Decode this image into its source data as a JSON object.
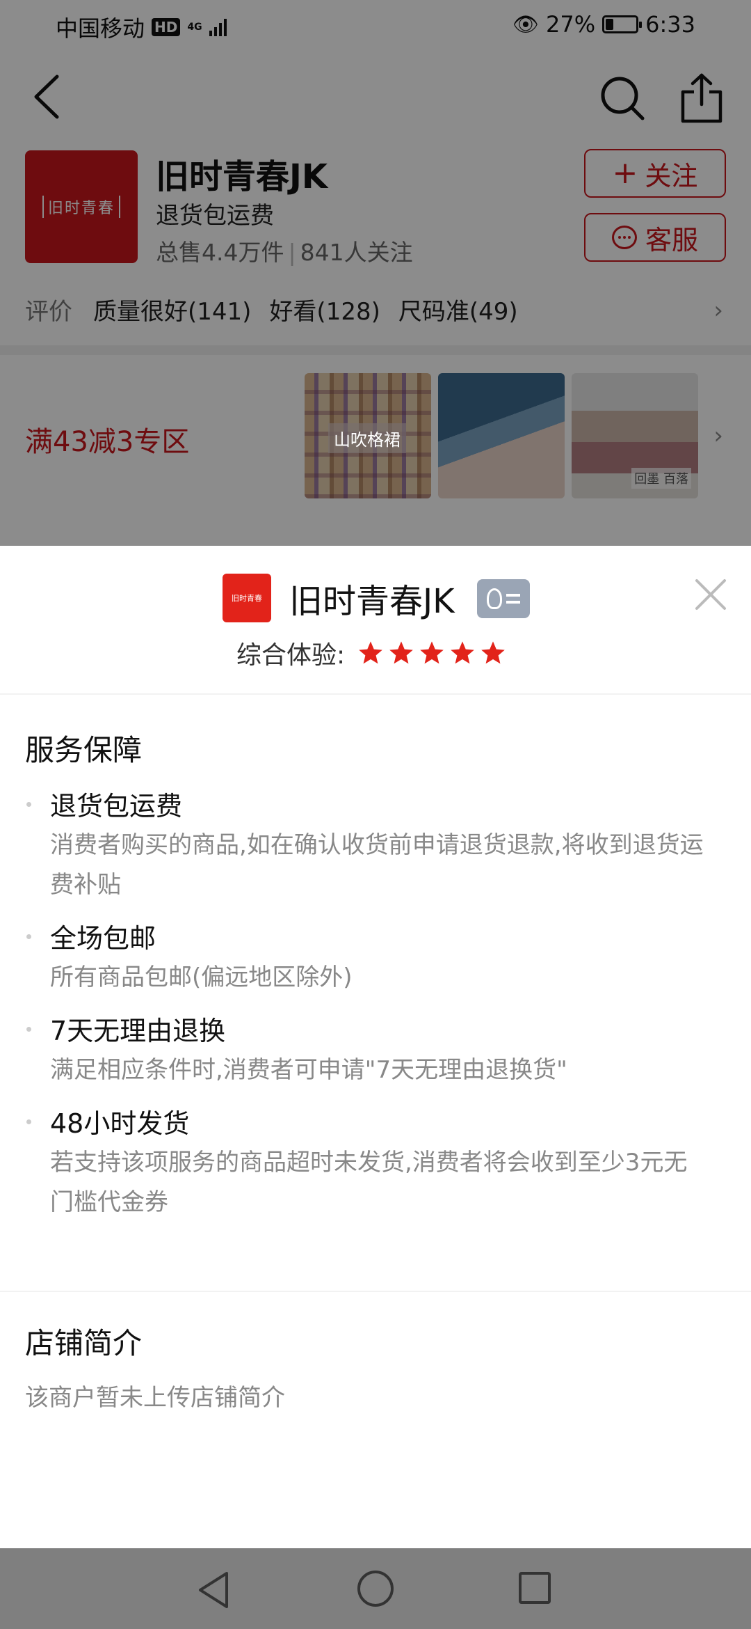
{
  "status_bar": {
    "carrier": "中国移动",
    "hd": "HD",
    "network": "4G",
    "battery_percent": "27%",
    "battery_level": 0.27,
    "time": "6:33"
  },
  "shop": {
    "logo_text": "旧时青春",
    "name": "旧时青春JK",
    "tag": "退货包运费",
    "total_sales": "总售4.4万件",
    "followers": "841人关注",
    "follow_label": "关注",
    "service_label": "客服"
  },
  "reviews": {
    "label": "评价",
    "tags": [
      "质量很好(141)",
      "好看(128)",
      "尺码准(49)"
    ]
  },
  "promo": {
    "title": "满43减3专区",
    "image_1_label": "山吹格裙",
    "image_3_label": "回墨 百落"
  },
  "sheet": {
    "logo_text": "旧时青春",
    "shop_name": "旧时青春JK",
    "rating_label": "综合体验:",
    "rating_stars": 5,
    "guarantee_title": "服务保障",
    "guarantees": [
      {
        "title": "退货包运费",
        "desc": "消费者购买的商品,如在确认收货前申请退货退款,将收到退货运费补贴"
      },
      {
        "title": "全场包邮",
        "desc": "所有商品包邮(偏远地区除外)"
      },
      {
        "title": "7天无理由退换",
        "desc": "满足相应条件时,消费者可申请\"7天无理由退换货\""
      },
      {
        "title": "48小时发货",
        "desc": "若支持该项服务的商品超时未发货,消费者将会收到至少3元无门槛代金券"
      }
    ],
    "intro_title": "店铺简介",
    "intro_desc": "该商户暂未上传店铺简介"
  },
  "colors": {
    "accent": "#c8161d",
    "star": "#e2231a",
    "overlay": "rgba(0,0,0,0.45)"
  },
  "icons": [
    "back-arrow-icon",
    "search-icon",
    "share-icon",
    "plus-icon",
    "chat-icon",
    "chevron-right-icon",
    "id-card-icon",
    "close-icon",
    "star-icon",
    "nav-back-icon",
    "nav-home-icon",
    "nav-recent-icon"
  ]
}
